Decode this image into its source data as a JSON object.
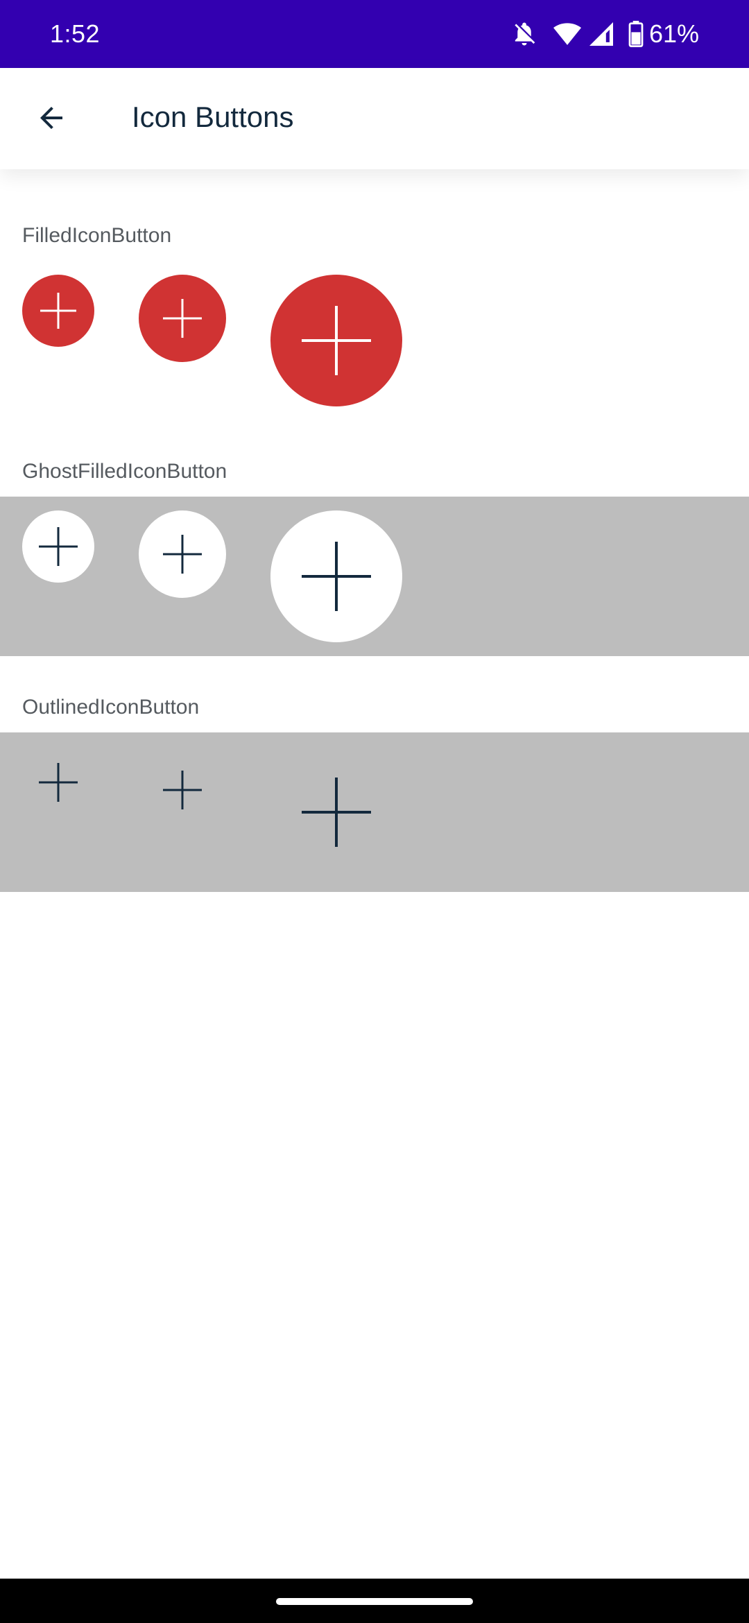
{
  "status_bar": {
    "time": "1:52",
    "battery_percent": "61%",
    "icons": [
      "bell-off-icon",
      "wifi-icon",
      "cellular-signal-icon",
      "battery-icon"
    ],
    "background_color": "#3300b0"
  },
  "app_bar": {
    "title": "Icon Buttons",
    "back_icon": "arrow-back-icon"
  },
  "sections": [
    {
      "label": "FilledIconButton",
      "style": "filled",
      "button_color": "#d03333",
      "icon_color": "#ffffff",
      "buttons": [
        "small",
        "medium",
        "large"
      ],
      "icon": "plus-icon"
    },
    {
      "label": "GhostFilledIconButton",
      "style": "ghost-filled",
      "background_color": "#bdbdbd",
      "button_color": "#ffffff",
      "icon_color": "#13293d",
      "buttons": [
        "small",
        "medium",
        "large"
      ],
      "icon": "plus-icon"
    },
    {
      "label": "OutlinedIconButton",
      "style": "outlined",
      "background_color": "#bdbdbd",
      "icon_color": "#13293d",
      "buttons": [
        "small",
        "medium",
        "large"
      ],
      "icon": "plus-icon"
    }
  ],
  "colors": {
    "title_text": "#13293d",
    "label_text": "#555a5f"
  }
}
